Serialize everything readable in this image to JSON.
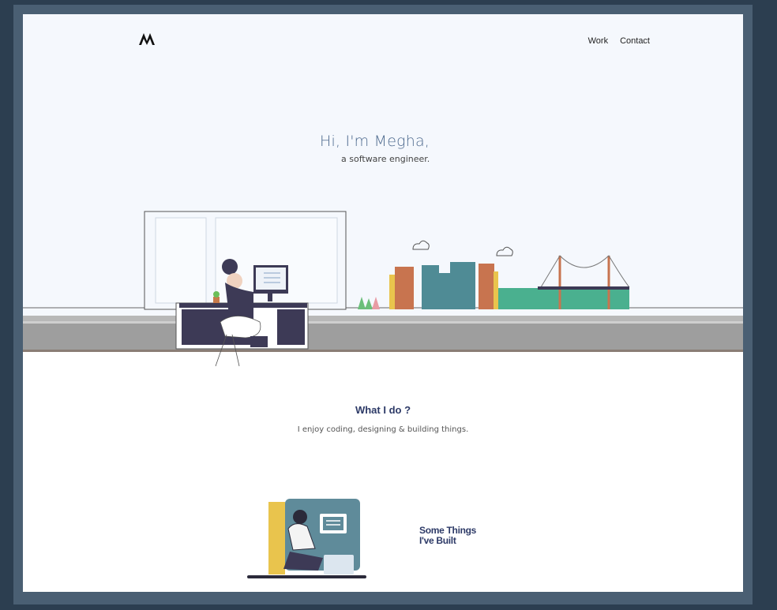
{
  "header": {
    "logo_icon": "megha-monogram-logo",
    "nav": [
      {
        "label": "Work"
      },
      {
        "label": "Contact"
      }
    ]
  },
  "hero": {
    "greeting": "Hi, I'm Megha,",
    "subtitle": "a software engineer.",
    "illustration_icon": "woman-at-desk-city-skyline-illustration"
  },
  "what_i_do": {
    "title": "What I do ?",
    "description": "I enjoy coding, designing & building things."
  },
  "built": {
    "label_line1": "Some Things",
    "label_line2": "I've Built",
    "illustration_icon": "woman-with-laptop-illustration"
  },
  "colors": {
    "page_bg": "#2c3e50",
    "hero_bg": "#f5f8fd",
    "accent_navy": "#2d3a67",
    "greeting_blue": "#4f6b8f"
  }
}
